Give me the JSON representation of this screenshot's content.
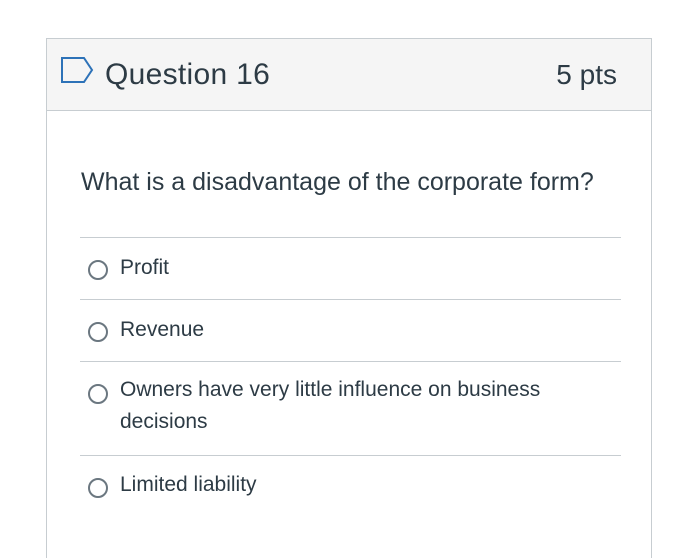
{
  "question": {
    "title": "Question 16",
    "points": "5 pts",
    "flag_icon": "flag-outline-icon",
    "accent_color": "#2d72b8",
    "prompt": "What is a disadvantage of the corporate form?",
    "answers": [
      {
        "label": "Profit",
        "selected": false
      },
      {
        "label": "Revenue",
        "selected": false
      },
      {
        "label": "Owners have very little influence on business decisions",
        "selected": false
      },
      {
        "label": "Limited liability",
        "selected": false
      }
    ]
  }
}
